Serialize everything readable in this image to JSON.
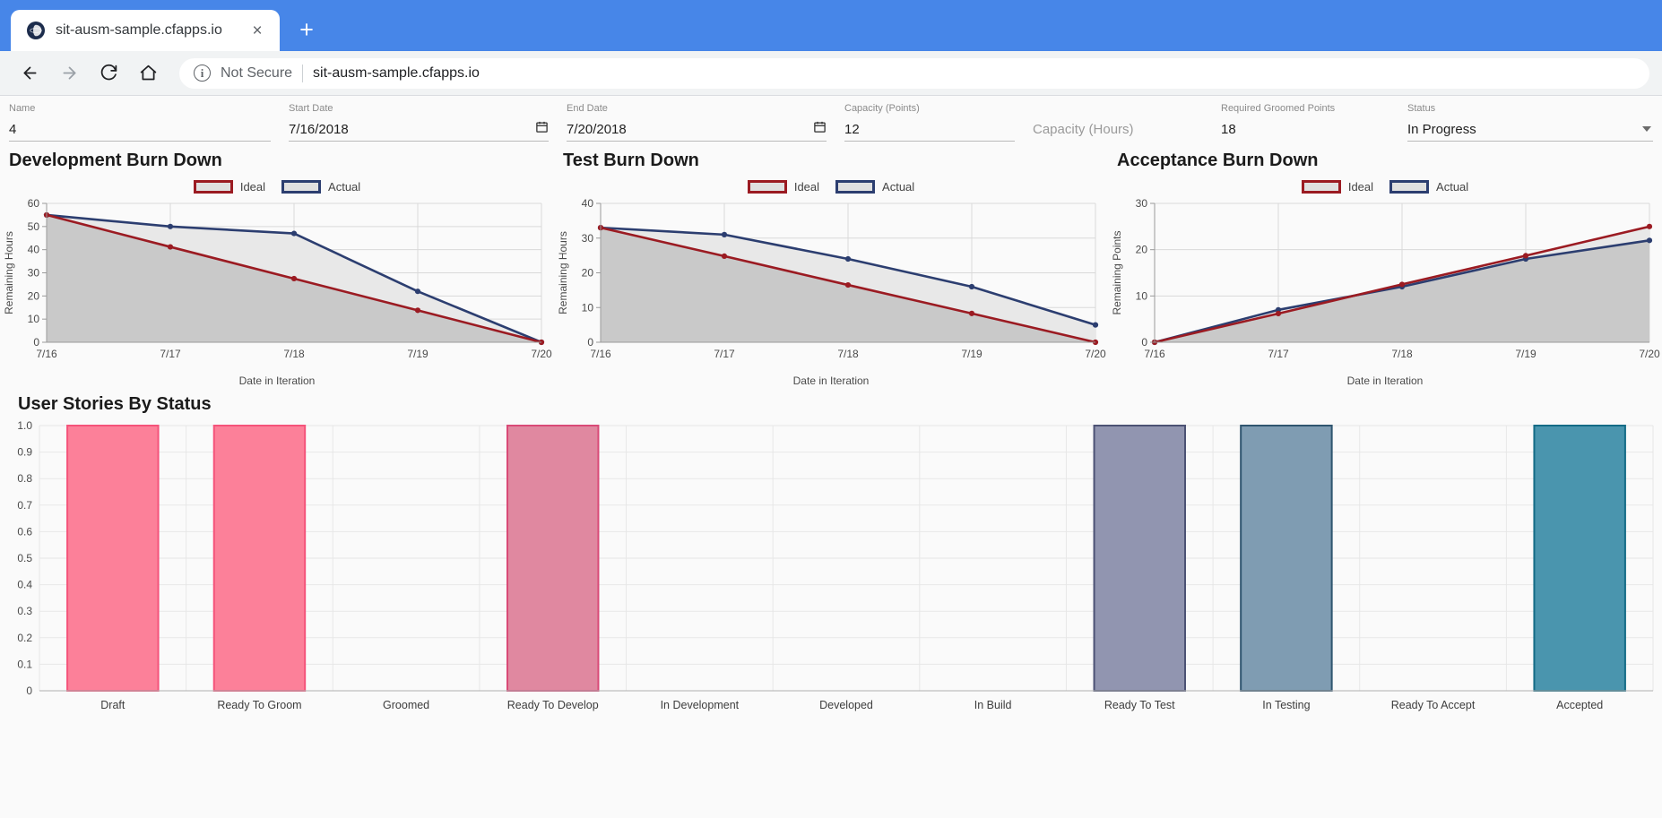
{
  "browser": {
    "tab": {
      "title": "sit-ausm-sample.cfapps.io",
      "favicon": "globe-icon",
      "close": "×"
    },
    "new_tab_label": "+",
    "back_icon": "←",
    "forward_icon": "→",
    "reload_icon": "↻",
    "home_icon": "⌂",
    "security_label": "Not Secure",
    "url": "sit-ausm-sample.cfapps.io"
  },
  "form": {
    "fields": [
      {
        "label": "Name",
        "value": "4",
        "type": "text",
        "placeholder": ""
      },
      {
        "label": "Start Date",
        "value": "7/16/2018",
        "type": "date",
        "placeholder": ""
      },
      {
        "label": "End Date",
        "value": "7/20/2018",
        "type": "date",
        "placeholder": ""
      },
      {
        "label": "Capacity (Points)",
        "value": "12",
        "type": "text",
        "placeholder": ""
      },
      {
        "label": "",
        "value": "",
        "type": "text",
        "placeholder": "Capacity (Hours)"
      },
      {
        "label": "Required Groomed Points",
        "value": "18",
        "type": "text",
        "placeholder": ""
      },
      {
        "label": "Status",
        "value": "In Progress",
        "type": "select",
        "placeholder": ""
      }
    ]
  },
  "colors": {
    "ideal_line": "#9b1b22",
    "actual_line": "#2c3e70",
    "plot_fill_dark": "#c9c9c9",
    "plot_fill_light": "#e8e8e8",
    "grid": "#d9d9d9",
    "bar_pink_bright": "#fc8099",
    "bar_pink_muted": "#e088a0",
    "bar_purple": "#9195b0",
    "bar_steel": "#7f9cb2",
    "bar_teal": "#4a95ae",
    "accent_blue": "#4786e8"
  },
  "chart_data": [
    {
      "type": "line",
      "title": "Development Burn Down",
      "xlabel": "Date in Iteration",
      "ylabel": "Remaining Hours",
      "categories": [
        "7/16",
        "7/17",
        "7/18",
        "7/19",
        "7/20"
      ],
      "yticks": [
        0,
        10,
        20,
        30,
        40,
        50,
        60
      ],
      "ylim": [
        0,
        60
      ],
      "grid": true,
      "legend": [
        "Ideal",
        "Actual"
      ],
      "legend_position": "top-center",
      "series": [
        {
          "name": "Ideal",
          "values": [
            55,
            41.2,
            27.5,
            13.8,
            0
          ]
        },
        {
          "name": "Actual",
          "values": [
            55,
            50,
            47,
            22,
            0
          ]
        }
      ]
    },
    {
      "type": "line",
      "title": "Test Burn Down",
      "xlabel": "Date in Iteration",
      "ylabel": "Remaining Hours",
      "categories": [
        "7/16",
        "7/17",
        "7/18",
        "7/19",
        "7/20"
      ],
      "yticks": [
        0,
        10,
        20,
        30,
        40
      ],
      "ylim": [
        0,
        40
      ],
      "grid": true,
      "legend": [
        "Ideal",
        "Actual"
      ],
      "legend_position": "top-center",
      "series": [
        {
          "name": "Ideal",
          "values": [
            33,
            24.8,
            16.5,
            8.3,
            0
          ]
        },
        {
          "name": "Actual",
          "values": [
            33,
            31,
            24,
            16,
            5
          ]
        }
      ]
    },
    {
      "type": "line",
      "title": "Acceptance Burn Down",
      "xlabel": "Date in Iteration",
      "ylabel": "Remaining Points",
      "categories": [
        "7/16",
        "7/17",
        "7/18",
        "7/19",
        "7/20"
      ],
      "yticks": [
        0,
        10,
        20,
        30
      ],
      "ylim": [
        0,
        30
      ],
      "grid": true,
      "legend": [
        "Ideal",
        "Actual"
      ],
      "legend_position": "top-center",
      "series": [
        {
          "name": "Ideal",
          "values": [
            0,
            6.2,
            12.5,
            18.7,
            25
          ]
        },
        {
          "name": "Actual",
          "values": [
            0,
            7,
            12,
            18,
            22
          ]
        }
      ]
    },
    {
      "type": "bar",
      "title": "User Stories By Status",
      "xlabel": "",
      "ylabel": "",
      "categories": [
        "Draft",
        "Ready To Groom",
        "Groomed",
        "Ready To Develop",
        "In Development",
        "Developed",
        "In Build",
        "Ready To Test",
        "In Testing",
        "Ready To Accept",
        "Accepted"
      ],
      "values": [
        1,
        1,
        0,
        1,
        0,
        0,
        0,
        1,
        1,
        0,
        1
      ],
      "bar_colors": [
        "#fc8099",
        "#fc8099",
        "none",
        "#e088a0",
        "none",
        "none",
        "none",
        "#9195b0",
        "#7f9cb2",
        "none",
        "#4a95ae"
      ],
      "yticks": [
        "0",
        "0.1",
        "0.2",
        "0.3",
        "0.4",
        "0.5",
        "0.6",
        "0.7",
        "0.8",
        "0.9",
        "1.0"
      ],
      "ylim": [
        0,
        1
      ],
      "grid": true
    }
  ]
}
